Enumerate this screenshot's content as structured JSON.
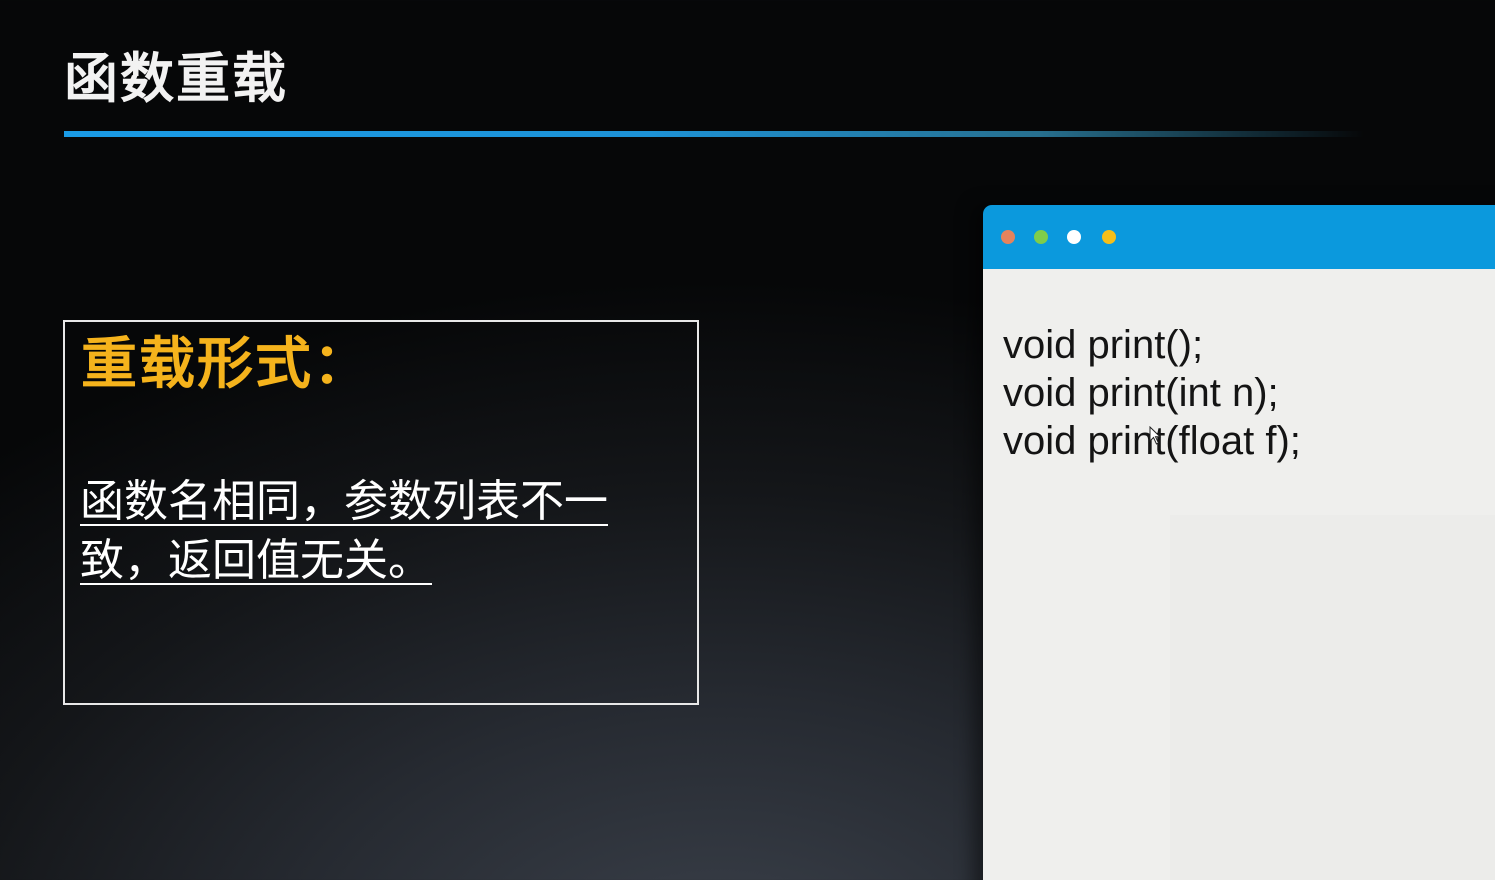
{
  "slide": {
    "title": "函数重载"
  },
  "info_box": {
    "heading": "重载形式：",
    "body": "函数名相同，参数列表不一致，返回值无关。"
  },
  "code_window": {
    "dots": [
      {
        "name": "orange",
        "color": "#e5835d"
      },
      {
        "name": "green",
        "color": "#7fcd4a"
      },
      {
        "name": "white",
        "color": "#ffffff"
      },
      {
        "name": "yellow",
        "color": "#f6bf1a"
      }
    ],
    "bar_color": "#0b99dd",
    "code_lines": [
      "void print();",
      "void print(int n);",
      "void print(float f);"
    ]
  },
  "colors": {
    "accent_blue": "#1a9be6",
    "heading_orange": "#f5b31c"
  }
}
